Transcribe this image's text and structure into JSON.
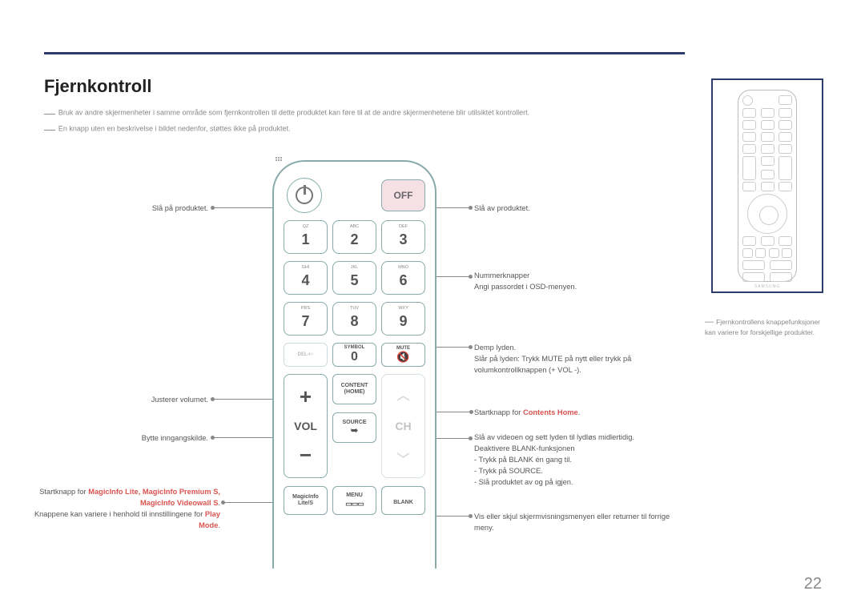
{
  "page_number": "22",
  "title": "Fjernkontroll",
  "notes": [
    "Bruk av andre skjermenheter i samme område som fjernkontrollen til dette produktet kan føre til at de andre skjermenhetene blir utilsiktet kontrollert.",
    "En knapp uten en beskrivelse i bildet nedenfor, støttes ikke på produktet."
  ],
  "labels_left": {
    "power_on": "Slå på produktet.",
    "volume": "Justerer volumet.",
    "source": "Bytte inngangskilde.",
    "magic_pre": "Startknapp for ",
    "magic_hl": "MagicInfo Lite, MagicInfo Premium S, MagicInfo Videowall S",
    "magic_post1": ".",
    "magic_line2": "Knappene kan variere i henhold til innstillingene for ",
    "magic_hl2": "Play Mode",
    "magic_post2": "."
  },
  "labels_right": {
    "off": "Slå av produktet.",
    "numbers_l1": "Nummerknapper",
    "numbers_l2": "Angi passordet i OSD-menyen.",
    "mute_l1": "Demp lyden.",
    "mute_l2": "Slår på lyden: Trykk MUTE på nytt eller trykk på volumkontrollknappen (+ VOL -).",
    "content_pre": "Startknapp for ",
    "content_hl": "Contents Home",
    "content_post": ".",
    "blank_l1": "Slå av videoen og sett lyden til lydløs midlertidig.",
    "blank_l2": "Deaktivere BLANK-funksjonen",
    "blank_l3": "- Trykk på BLANK én gang til.",
    "blank_l4": "- Trykk på SOURCE.",
    "blank_l5": "- Slå produktet av og på igjen.",
    "menu": "Vis eller skjul skjermvisningsmenyen eller returner til forrige meny."
  },
  "thumb_note": "Fjernkontrollens knappefunksjoner kan variere for forskjellige produkter.",
  "remote": {
    "off": "OFF",
    "keypad": [
      {
        "sub": "QZ",
        "n": "1"
      },
      {
        "sub": "ABC",
        "n": "2"
      },
      {
        "sub": "DEF",
        "n": "3"
      },
      {
        "sub": "GHI",
        "n": "4"
      },
      {
        "sub": "JKL",
        "n": "5"
      },
      {
        "sub": "MNO",
        "n": "6"
      },
      {
        "sub": "PRS",
        "n": "7"
      },
      {
        "sub": "TUV",
        "n": "8"
      },
      {
        "sub": "WXY",
        "n": "9"
      }
    ],
    "del": "DEL-/--",
    "symbol": "SYMBOL",
    "zero": "0",
    "mute": "MUTE",
    "vol": "VOL",
    "ch": "CH",
    "content_home_l1": "CONTENT",
    "content_home_l2": "(HOME)",
    "source": "SOURCE",
    "magicinfo_l1": "MagicInfo",
    "magicinfo_l2": "Lite/S",
    "menu": "MENU",
    "blank": "BLANK"
  },
  "thumb_brand": "SAMSUNG"
}
